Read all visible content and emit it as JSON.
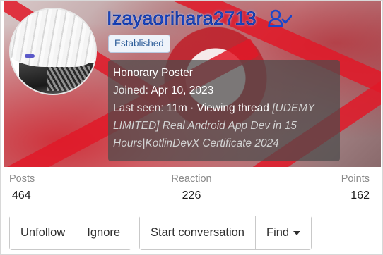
{
  "profile": {
    "username": "Izayaorihara2713",
    "badge": "Established",
    "title": "Honorary Poster",
    "joined_label": "Joined:",
    "joined_value": "Apr 10, 2023",
    "last_seen_label": "Last seen:",
    "last_seen_time": "11m",
    "separator": "·",
    "activity_label": "Viewing thread",
    "activity_thread_line1": "[UDEMY",
    "activity_thread_line2": "LIMITED] Real Android App Dev in 15",
    "activity_thread_line3": "Hours|KotlinDevX Certificate 2024"
  },
  "stats": {
    "posts_label": "Posts",
    "posts_value": "464",
    "reaction_label": "Reaction",
    "reaction_value": "226",
    "points_label": "Points",
    "points_value": "162"
  },
  "actions": {
    "unfollow": "Unfollow",
    "ignore": "Ignore",
    "start_conversation": "Start conversation",
    "find": "Find"
  },
  "icons": {
    "username_icon": "user-check-icon",
    "find_icon": "caret-down-icon"
  },
  "colors": {
    "username": "#1a47c9",
    "badge_text": "#2f5f9a",
    "banner_red": "#e11928"
  }
}
